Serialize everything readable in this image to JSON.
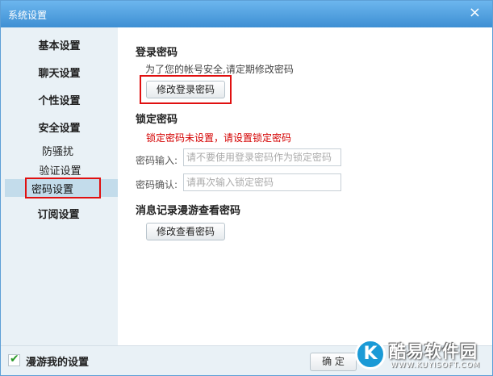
{
  "window": {
    "title": "系统设置",
    "close_glyph": "×"
  },
  "sidebar": {
    "items": [
      {
        "label": "基本设置"
      },
      {
        "label": "聊天设置"
      },
      {
        "label": "个性设置"
      },
      {
        "label": "安全设置"
      }
    ],
    "security_subitems": [
      {
        "label": "防骚扰"
      },
      {
        "label": "验证设置"
      },
      {
        "label": "密码设置",
        "selected": true
      }
    ],
    "subscription": {
      "label": "订阅设置"
    }
  },
  "content": {
    "login_password": {
      "title": "登录密码",
      "hint": "为了您的帐号安全,请定期修改密码",
      "change_button": "修改登录密码"
    },
    "lock_password": {
      "title": "锁定密码",
      "warning": "锁定密码未设置，请设置锁定密码",
      "input_label": "密码输入:",
      "input_placeholder": "请不要使用登录密码作为锁定密码",
      "confirm_label": "密码确认:",
      "confirm_placeholder": "请再次输入锁定密码"
    },
    "history_password": {
      "title": "消息记录漫游查看密码",
      "change_button": "修改查看密码"
    }
  },
  "footer": {
    "roaming_checkbox_label": "漫游我的设置",
    "roaming_checked": true,
    "ok_button": "确 定"
  },
  "watermark": {
    "logo_letter": "K",
    "text": "酷易软件园",
    "url": "WWW.KUYISOFT.COM"
  },
  "colors": {
    "title_bar": "#3e8fd3",
    "sidebar_bg": "#e9f1f6",
    "selected_bg": "#c3dceb",
    "highlight_red": "#e01010",
    "warning_text": "#d40000"
  }
}
